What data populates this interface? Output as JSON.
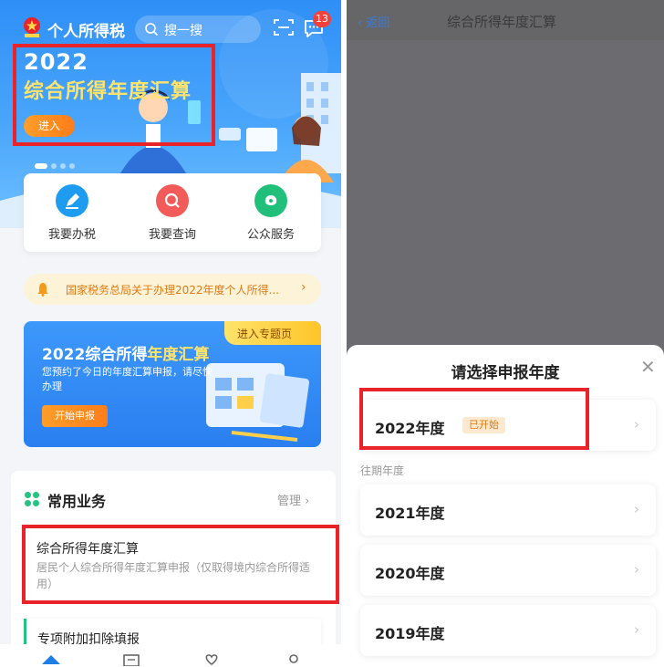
{
  "left": {
    "app_title": "个人所得税",
    "search_placeholder": "搜一搜",
    "message_badge": "13",
    "banner": {
      "year": "2022",
      "title": "综合所得年度汇算",
      "enter_label": "进入"
    },
    "quick_actions": [
      {
        "label": "我要办税",
        "icon": "pen-icon"
      },
      {
        "label": "我要查询",
        "icon": "search-icon"
      },
      {
        "label": "公众服务",
        "icon": "service-icon"
      }
    ],
    "notice_text": "国家税务总局关于办理2022年度个人所得...",
    "promo": {
      "tag": "进入专题页",
      "title_a": "2022综合所得",
      "title_b": "年度汇算",
      "desc": "您预约了今日的年度汇算申报，请尽快办理",
      "button": "开始申报"
    },
    "common": {
      "title": "常用业务",
      "manage": "管理",
      "services": [
        {
          "title": "综合所得年度汇算",
          "desc": "居民个人综合所得年度汇算申报（仅取得境内综合所得适用）"
        },
        {
          "title": "专项附加扣除填报",
          "desc": ""
        }
      ]
    },
    "colors": {
      "brand_blue": "#2f8ff7",
      "highlight_red": "#e8232a",
      "accent_orange": "#ff8a1f"
    }
  },
  "right": {
    "nav": {
      "back": "返回",
      "title": "综合所得年度汇算"
    },
    "sheet": {
      "title": "请选择申报年度",
      "current": {
        "label": "2022年度",
        "status": "已开始"
      },
      "past_label": "往期年度",
      "past": [
        {
          "label": "2021年度"
        },
        {
          "label": "2020年度"
        },
        {
          "label": "2019年度"
        }
      ]
    }
  }
}
